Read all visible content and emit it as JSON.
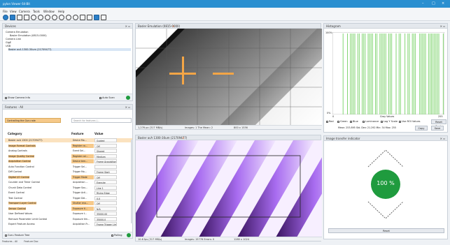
{
  "window": {
    "title": "pylon Viewer 64-Bit",
    "minimize": "–",
    "maximize": "□",
    "close": "×"
  },
  "menu": [
    "File",
    "View",
    "Camera",
    "Tools",
    "Window",
    "Help"
  ],
  "toolbar_icons": [
    "open-icon",
    "save-icon",
    "single-shot-icon",
    "continuous-icon",
    "stop-icon",
    "zoom-in-icon",
    "zoom-out-icon",
    "zoom-fit-icon",
    "zoom-100-icon",
    "crosshair-icon",
    "roi-icon",
    "histogram-icon",
    "layout-icon"
  ],
  "devices_panel": {
    "title": "Devices",
    "items": [
      {
        "label": "Camera Emulation",
        "level": 0
      },
      {
        "label": "Basler Emulation (0815-0000)",
        "level": 1
      },
      {
        "label": "Camera Link",
        "level": 0
      },
      {
        "label": "GigE",
        "level": 0
      },
      {
        "label": "USB",
        "level": 0
      },
      {
        "label": "Basler acA 1300-30um (21709477)",
        "level": 1,
        "selected": true
      }
    ],
    "show_emulator_label": "Show Camera Info",
    "auto_scan_label": "Auto Scan"
  },
  "features_panel": {
    "title": "Features - All",
    "dropdown": "Controlling the Guru role",
    "search_placeholder": "Search for features (...",
    "col_category": "Category",
    "col_feature": "Feature",
    "col_value": "Value",
    "rows": [
      {
        "cat": "Basler acA 1300 (21709477)",
        "feat": "Device Mo...",
        "val": "Guided",
        "hl": "lorange"
      },
      {
        "cat": "Image Format Controls",
        "feat": "Register ca...",
        "val": "Off",
        "hl": "orange"
      },
      {
        "cat": "Analog Controls",
        "feat": "Event Sel...",
        "val": "Shared",
        "hl": ""
      },
      {
        "cat": "Image Quality Control",
        "feat": "Register cal...",
        "val": "Medium",
        "hl": "orange"
      },
      {
        "cat": "Acquisition Control",
        "feat": "Device tem...",
        "val": "Frame Acquisition",
        "hl": "orange"
      },
      {
        "cat": "Auto Function Control",
        "feat": "Trigger Sel...",
        "val": "",
        "hl": ""
      },
      {
        "cat": "Diff Control",
        "feat": "Trigger Mo...",
        "val": "Frame Start",
        "hl": ""
      },
      {
        "cat": "Digital I/O Control",
        "feat": "Trigger Mode",
        "val": "Off",
        "hl": "orange"
      },
      {
        "cat": "Counter and Timer Control",
        "feat": "Acquisition ...",
        "val": "Execute",
        "hl": ""
      },
      {
        "cat": "Chunk Data Control",
        "feat": "Trigger Sou...",
        "val": "Line 1",
        "hl": ""
      },
      {
        "cat": "Event Control",
        "feat": "Trigger Acti...",
        "val": "Rising Edge",
        "hl": ""
      },
      {
        "cat": "Test Control",
        "feat": "Trigger Del...",
        "val": "0.0",
        "hl": ""
      },
      {
        "cat": "Transport Layer Control",
        "feat": "Shutter ena...",
        "val": "Off",
        "hl": "orange"
      },
      {
        "cat": "Sensor Control",
        "feat": "Exposure ti...",
        "val": "N/A",
        "hl": "orange"
      },
      {
        "cat": "User Defined Values",
        "feat": "Exposure t...",
        "val": "35000.00",
        "hl": ""
      },
      {
        "cat": "Remove Parameter Limit Control",
        "feat": "Exposure tim...",
        "val": "35000.0",
        "hl": ""
      },
      {
        "cat": "Expert Feature Access",
        "feat": "Acquisition Fr...",
        "val": "Frame Trigger Limit",
        "hl": ""
      }
    ],
    "bottom_label": "Guru Feature Tree",
    "polling_label": "Polling",
    "tabs": [
      "Features - All",
      "Feature Doc"
    ]
  },
  "viewer_top": {
    "title": "Basler Emulation (0815-0000)",
    "status": [
      "1,276 px (317 MB/s)",
      "Images: 1 The Mean: 2",
      "800 x 1536"
    ]
  },
  "viewer_bottom": {
    "title": "Basler acA 1300-30um (21709477)",
    "status": [
      "10.6 fps (317 MB/s)",
      "Images: 15776 Errors: 0",
      "1280 x 1024"
    ]
  },
  "histogram": {
    "title": "Histogram",
    "y_top": "100%",
    "y_bottom": "0%",
    "x_left": "0",
    "x_mid": "Gray Values",
    "x_right": "255",
    "checks": [
      "Red",
      "Green",
      "Blue",
      "Luminance",
      "Log Y Scale",
      "Use ROI Values",
      "Reset Scale"
    ],
    "stats": "Mean: 253.895   Std. Dev: 21.292   Min: 34   Max: 255",
    "copy_label": "Copy",
    "save_label": "Save",
    "bars": [
      0,
      0,
      0,
      0,
      0,
      0,
      0,
      1,
      0,
      0,
      1,
      0,
      1,
      1,
      1,
      1,
      0,
      1,
      1,
      0,
      1,
      1,
      1,
      0,
      1,
      1,
      1,
      1,
      0,
      1,
      1,
      0,
      1,
      1,
      1,
      1,
      1,
      0,
      1,
      1,
      1,
      0,
      0,
      1,
      0,
      1,
      1,
      0,
      0,
      1,
      0,
      1,
      1,
      0,
      1,
      1,
      1,
      0,
      0,
      1,
      1,
      1,
      1,
      1,
      0,
      1,
      1,
      1,
      1,
      1,
      1,
      1,
      1,
      0,
      0,
      1
    ]
  },
  "transfer": {
    "title": "Image transfer indicator",
    "percent": "100 %",
    "percent_value": 100,
    "button": "Reset"
  },
  "colors": {
    "accent": "#2a8fd0",
    "green": "#1f9b3e",
    "orange": "#f3a546",
    "hist": "#7ed46d",
    "purple": "#b27cf0"
  }
}
